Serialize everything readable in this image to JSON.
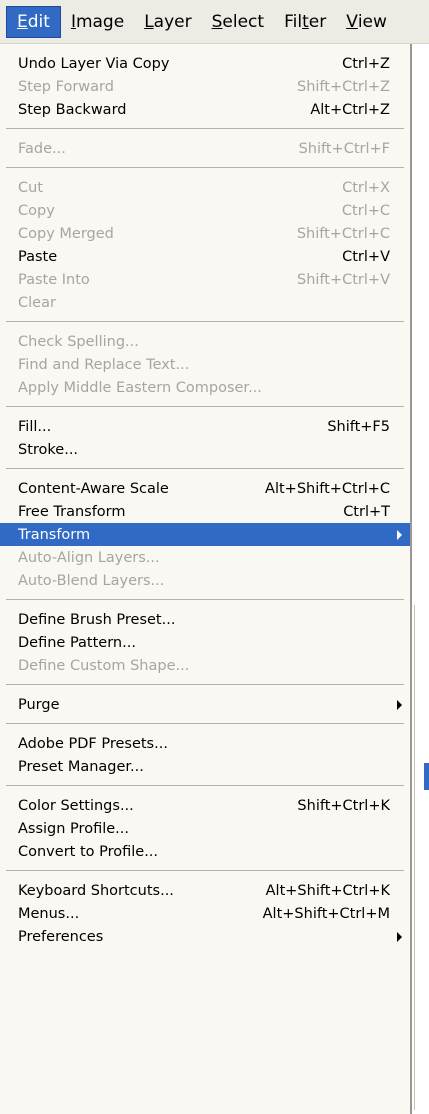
{
  "menubar": {
    "items": [
      {
        "label": "Edit",
        "u": "E",
        "rest": "dit",
        "active": true
      },
      {
        "label": "Image",
        "u": "I",
        "rest": "mage",
        "active": false
      },
      {
        "label": "Layer",
        "u": "L",
        "rest": "ayer",
        "active": false
      },
      {
        "label": "Select",
        "u": "S",
        "rest": "elect",
        "active": false
      },
      {
        "label": "Filter",
        "pre": "Fil",
        "u": "t",
        "rest": "er",
        "active": false
      },
      {
        "label": "View",
        "u": "V",
        "rest": "iew",
        "active": false
      }
    ]
  },
  "menu": {
    "groups": [
      [
        {
          "label": "Undo Layer Via Copy",
          "shortcut": "Ctrl+Z",
          "enabled": true
        },
        {
          "label": "Step Forward",
          "shortcut": "Shift+Ctrl+Z",
          "enabled": false
        },
        {
          "label": "Step Backward",
          "shortcut": "Alt+Ctrl+Z",
          "enabled": true
        }
      ],
      [
        {
          "label": "Fade...",
          "shortcut": "Shift+Ctrl+F",
          "enabled": false
        }
      ],
      [
        {
          "label": "Cut",
          "shortcut": "Ctrl+X",
          "enabled": false
        },
        {
          "label": "Copy",
          "shortcut": "Ctrl+C",
          "enabled": false
        },
        {
          "label": "Copy Merged",
          "shortcut": "Shift+Ctrl+C",
          "enabled": false
        },
        {
          "label": "Paste",
          "shortcut": "Ctrl+V",
          "enabled": true
        },
        {
          "label": "Paste Into",
          "shortcut": "Shift+Ctrl+V",
          "enabled": false
        },
        {
          "label": "Clear",
          "shortcut": "",
          "enabled": false
        }
      ],
      [
        {
          "label": "Check Spelling...",
          "shortcut": "",
          "enabled": false
        },
        {
          "label": "Find and Replace Text...",
          "shortcut": "",
          "enabled": false
        },
        {
          "label": "Apply Middle Eastern Composer...",
          "shortcut": "",
          "enabled": false
        }
      ],
      [
        {
          "label": "Fill...",
          "shortcut": "Shift+F5",
          "enabled": true
        },
        {
          "label": "Stroke...",
          "shortcut": "",
          "enabled": true
        }
      ],
      [
        {
          "label": "Content-Aware Scale",
          "shortcut": "Alt+Shift+Ctrl+C",
          "enabled": true
        },
        {
          "label": "Free Transform",
          "shortcut": "Ctrl+T",
          "enabled": true
        },
        {
          "label": "Transform",
          "shortcut": "",
          "enabled": true,
          "submenu": true,
          "highlighted": true
        },
        {
          "label": "Auto-Align Layers...",
          "shortcut": "",
          "enabled": false
        },
        {
          "label": "Auto-Blend Layers...",
          "shortcut": "",
          "enabled": false
        }
      ],
      [
        {
          "label": "Define Brush Preset...",
          "shortcut": "",
          "enabled": true
        },
        {
          "label": "Define Pattern...",
          "shortcut": "",
          "enabled": true
        },
        {
          "label": "Define Custom Shape...",
          "shortcut": "",
          "enabled": false
        }
      ],
      [
        {
          "label": "Purge",
          "shortcut": "",
          "enabled": true,
          "submenu": true
        }
      ],
      [
        {
          "label": "Adobe PDF Presets...",
          "shortcut": "",
          "enabled": true
        },
        {
          "label": "Preset Manager...",
          "shortcut": "",
          "enabled": true
        }
      ],
      [
        {
          "label": "Color Settings...",
          "shortcut": "Shift+Ctrl+K",
          "enabled": true
        },
        {
          "label": "Assign Profile...",
          "shortcut": "",
          "enabled": true
        },
        {
          "label": "Convert to Profile...",
          "shortcut": "",
          "enabled": true
        }
      ],
      [
        {
          "label": "Keyboard Shortcuts...",
          "shortcut": "Alt+Shift+Ctrl+K",
          "enabled": true
        },
        {
          "label": "Menus...",
          "shortcut": "Alt+Shift+Ctrl+M",
          "enabled": true
        },
        {
          "label": "Preferences",
          "shortcut": "",
          "enabled": true,
          "submenu": true
        }
      ]
    ]
  },
  "colors": {
    "highlight": "#316ac5",
    "disabled_text": "#a7a69d",
    "menu_bg": "#f9f8f3",
    "menubar_bg": "#ecebe4"
  }
}
